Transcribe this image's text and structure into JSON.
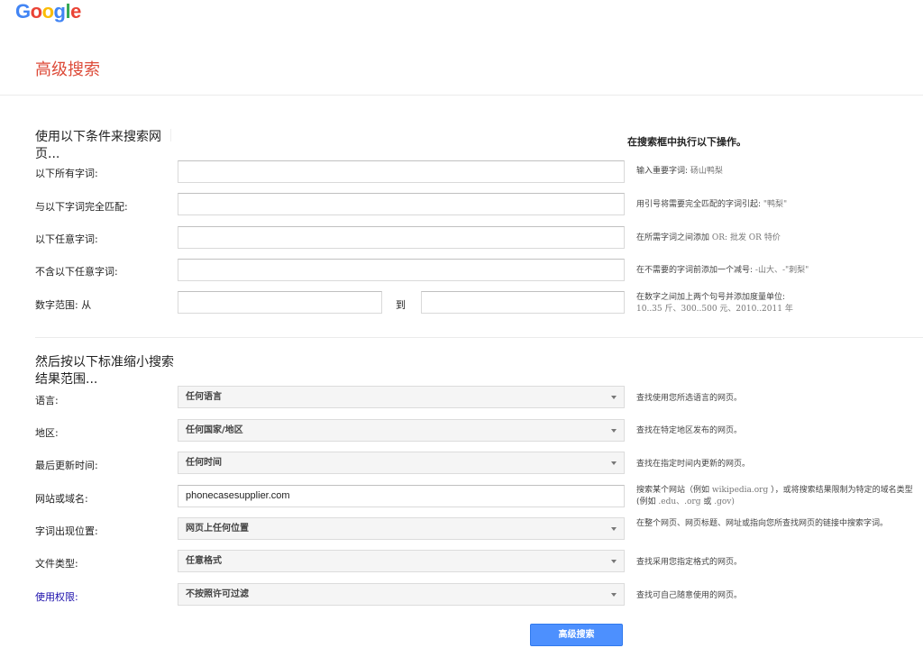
{
  "logo": {
    "letters": [
      "G",
      "o",
      "o",
      "g",
      "l",
      "e"
    ],
    "colors": [
      "#4285f4",
      "#ea4335",
      "#fbbc05",
      "#4285f4",
      "#34a853",
      "#ea4335"
    ]
  },
  "page_title": "高级搜索",
  "section1": {
    "title": "使用以下条件来搜索网页...",
    "hint_title": "在搜索框中执行以下操作。",
    "rows": [
      {
        "label": "以下所有字词:",
        "hint": "输入重要字词:",
        "example": "砀山鸭梨"
      },
      {
        "label": "与以下字词完全匹配:",
        "hint": "用引号将需要完全匹配的字词引起:",
        "example": "\"鸭梨\""
      },
      {
        "label": "以下任意字词:",
        "hint": "在所需字词之间添加",
        "example": "OR: 批发 OR 特价"
      },
      {
        "label": "不含以下任意字词:",
        "hint": "在不需要的字词前添加一个减号:",
        "example": "-山大、-\"刺梨\""
      },
      {
        "label": "数字范围: 从",
        "to": "到",
        "hint": "在数字之间加上两个句号并添加度量单位:",
        "example": "10..35 斤、300..500 元、2010..2011 年"
      }
    ]
  },
  "section2": {
    "title": "然后按以下标准缩小搜索结果范围...",
    "rows": [
      {
        "label": "语言:",
        "value": "任何语言",
        "hint": "查找使用您所选语言的网页。"
      },
      {
        "label": "地区:",
        "value": "任何国家/地区",
        "hint": "查找在特定地区发布的网页。"
      },
      {
        "label": "最后更新时间:",
        "value": "任何时间",
        "hint": "查找在指定时间内更新的网页。"
      },
      {
        "label": "网站或域名:",
        "value": "phonecasesupplier.com",
        "hint_a": "搜索某个网站（例如",
        "hint_b": "wikipedia.org",
        "hint_c": "），或将搜索结果限制为特定的域名类型(例如",
        "hint_d": ".edu、.org",
        "hint_e": "或",
        "hint_f": ".gov)"
      },
      {
        "label": "字词出现位置:",
        "value": "网页上任何位置",
        "hint": "在整个网页、网页标题、网址或指向您所查找网页的链接中搜索字词。"
      },
      {
        "label": "文件类型:",
        "value": "任意格式",
        "hint": "查找采用您指定格式的网页。"
      },
      {
        "label": "使用权限:",
        "value": "不按照许可过滤",
        "hint": "查找可自己随意使用的网页。"
      }
    ]
  },
  "submit_label": "高级搜索"
}
